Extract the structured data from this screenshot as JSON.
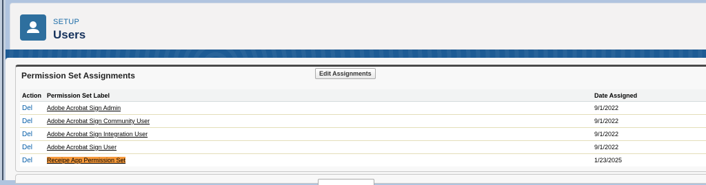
{
  "header": {
    "section_label": "SETUP",
    "title": "Users",
    "icon": "user-icon"
  },
  "related_list": {
    "title": "Permission Set Assignments",
    "edit_button_label": "Edit Assignments",
    "columns": {
      "action": "Action",
      "label": "Permission Set Label",
      "date": "Date Assigned"
    },
    "rows": [
      {
        "action": "Del",
        "label": "Adobe Acrobat Sign Admin",
        "date": "9/1/2022",
        "highlighted": false
      },
      {
        "action": "Del",
        "label": "Adobe Acrobat Sign Community User",
        "date": "9/1/2022",
        "highlighted": false
      },
      {
        "action": "Del",
        "label": "Adobe Acrobat Sign Integration User",
        "date": "9/1/2022",
        "highlighted": false
      },
      {
        "action": "Del",
        "label": "Adobe Acrobat Sign User",
        "date": "9/1/2022",
        "highlighted": false
      },
      {
        "action": "Del",
        "label": "Receipe App Permission Set",
        "date": "1/23/2025",
        "highlighted": true
      }
    ]
  },
  "colors": {
    "brand_blue": "#1d5b94",
    "icon_bg": "#2e6f9e",
    "link_blue": "#015ba7",
    "highlight": "#f79a3b"
  }
}
